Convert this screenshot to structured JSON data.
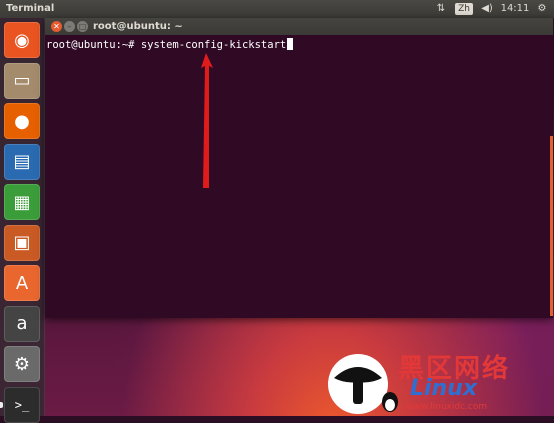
{
  "top_panel": {
    "app_title": "Terminal",
    "indicators": {
      "network": "⇅",
      "language": "Zh",
      "sound": "◀)",
      "time": "14:11",
      "settings": "⚙"
    }
  },
  "launcher": {
    "items": [
      {
        "name": "dash-home",
        "glyph": "◉",
        "color": "#e95420"
      },
      {
        "name": "files",
        "glyph": "▭",
        "color": "#a38b6c"
      },
      {
        "name": "firefox",
        "glyph": "●",
        "color": "#e66000"
      },
      {
        "name": "libreoffice-writer",
        "glyph": "▤",
        "color": "#2a6ab0"
      },
      {
        "name": "libreoffice-calc",
        "glyph": "▦",
        "color": "#3b9d3a"
      },
      {
        "name": "libreoffice-impress",
        "glyph": "▣",
        "color": "#c95a24"
      },
      {
        "name": "ubuntu-software",
        "glyph": "A",
        "color": "#e9662f"
      },
      {
        "name": "amazon",
        "glyph": "a",
        "color": "#444444"
      },
      {
        "name": "system-settings",
        "glyph": "⚙",
        "color": "#6a6a6a"
      },
      {
        "name": "terminal",
        "glyph": ">_",
        "color": "#2c2c2c"
      }
    ]
  },
  "terminal": {
    "window_title": "root@ubuntu: ~",
    "prompt": "root@ubuntu:~# ",
    "command": "system-config-kickstart"
  },
  "watermark": {
    "cn_text": "黑区网络",
    "linux_text": "Linux",
    "url": "www.linuxidc.com"
  }
}
